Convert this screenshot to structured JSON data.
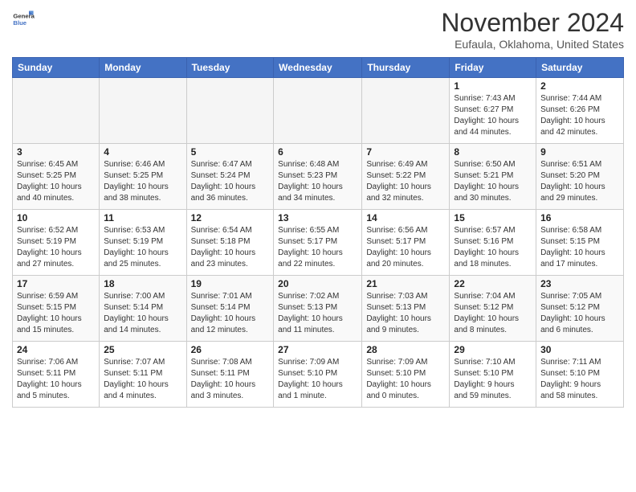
{
  "header": {
    "logo_general": "General",
    "logo_blue": "Blue",
    "month_title": "November 2024",
    "location": "Eufaula, Oklahoma, United States"
  },
  "days_of_week": [
    "Sunday",
    "Monday",
    "Tuesday",
    "Wednesday",
    "Thursday",
    "Friday",
    "Saturday"
  ],
  "weeks": [
    [
      {
        "day": "",
        "info": ""
      },
      {
        "day": "",
        "info": ""
      },
      {
        "day": "",
        "info": ""
      },
      {
        "day": "",
        "info": ""
      },
      {
        "day": "",
        "info": ""
      },
      {
        "day": "1",
        "info": "Sunrise: 7:43 AM\nSunset: 6:27 PM\nDaylight: 10 hours\nand 44 minutes."
      },
      {
        "day": "2",
        "info": "Sunrise: 7:44 AM\nSunset: 6:26 PM\nDaylight: 10 hours\nand 42 minutes."
      }
    ],
    [
      {
        "day": "3",
        "info": "Sunrise: 6:45 AM\nSunset: 5:25 PM\nDaylight: 10 hours\nand 40 minutes."
      },
      {
        "day": "4",
        "info": "Sunrise: 6:46 AM\nSunset: 5:25 PM\nDaylight: 10 hours\nand 38 minutes."
      },
      {
        "day": "5",
        "info": "Sunrise: 6:47 AM\nSunset: 5:24 PM\nDaylight: 10 hours\nand 36 minutes."
      },
      {
        "day": "6",
        "info": "Sunrise: 6:48 AM\nSunset: 5:23 PM\nDaylight: 10 hours\nand 34 minutes."
      },
      {
        "day": "7",
        "info": "Sunrise: 6:49 AM\nSunset: 5:22 PM\nDaylight: 10 hours\nand 32 minutes."
      },
      {
        "day": "8",
        "info": "Sunrise: 6:50 AM\nSunset: 5:21 PM\nDaylight: 10 hours\nand 30 minutes."
      },
      {
        "day": "9",
        "info": "Sunrise: 6:51 AM\nSunset: 5:20 PM\nDaylight: 10 hours\nand 29 minutes."
      }
    ],
    [
      {
        "day": "10",
        "info": "Sunrise: 6:52 AM\nSunset: 5:19 PM\nDaylight: 10 hours\nand 27 minutes."
      },
      {
        "day": "11",
        "info": "Sunrise: 6:53 AM\nSunset: 5:19 PM\nDaylight: 10 hours\nand 25 minutes."
      },
      {
        "day": "12",
        "info": "Sunrise: 6:54 AM\nSunset: 5:18 PM\nDaylight: 10 hours\nand 23 minutes."
      },
      {
        "day": "13",
        "info": "Sunrise: 6:55 AM\nSunset: 5:17 PM\nDaylight: 10 hours\nand 22 minutes."
      },
      {
        "day": "14",
        "info": "Sunrise: 6:56 AM\nSunset: 5:17 PM\nDaylight: 10 hours\nand 20 minutes."
      },
      {
        "day": "15",
        "info": "Sunrise: 6:57 AM\nSunset: 5:16 PM\nDaylight: 10 hours\nand 18 minutes."
      },
      {
        "day": "16",
        "info": "Sunrise: 6:58 AM\nSunset: 5:15 PM\nDaylight: 10 hours\nand 17 minutes."
      }
    ],
    [
      {
        "day": "17",
        "info": "Sunrise: 6:59 AM\nSunset: 5:15 PM\nDaylight: 10 hours\nand 15 minutes."
      },
      {
        "day": "18",
        "info": "Sunrise: 7:00 AM\nSunset: 5:14 PM\nDaylight: 10 hours\nand 14 minutes."
      },
      {
        "day": "19",
        "info": "Sunrise: 7:01 AM\nSunset: 5:14 PM\nDaylight: 10 hours\nand 12 minutes."
      },
      {
        "day": "20",
        "info": "Sunrise: 7:02 AM\nSunset: 5:13 PM\nDaylight: 10 hours\nand 11 minutes."
      },
      {
        "day": "21",
        "info": "Sunrise: 7:03 AM\nSunset: 5:13 PM\nDaylight: 10 hours\nand 9 minutes."
      },
      {
        "day": "22",
        "info": "Sunrise: 7:04 AM\nSunset: 5:12 PM\nDaylight: 10 hours\nand 8 minutes."
      },
      {
        "day": "23",
        "info": "Sunrise: 7:05 AM\nSunset: 5:12 PM\nDaylight: 10 hours\nand 6 minutes."
      }
    ],
    [
      {
        "day": "24",
        "info": "Sunrise: 7:06 AM\nSunset: 5:11 PM\nDaylight: 10 hours\nand 5 minutes."
      },
      {
        "day": "25",
        "info": "Sunrise: 7:07 AM\nSunset: 5:11 PM\nDaylight: 10 hours\nand 4 minutes."
      },
      {
        "day": "26",
        "info": "Sunrise: 7:08 AM\nSunset: 5:11 PM\nDaylight: 10 hours\nand 3 minutes."
      },
      {
        "day": "27",
        "info": "Sunrise: 7:09 AM\nSunset: 5:10 PM\nDaylight: 10 hours\nand 1 minute."
      },
      {
        "day": "28",
        "info": "Sunrise: 7:09 AM\nSunset: 5:10 PM\nDaylight: 10 hours\nand 0 minutes."
      },
      {
        "day": "29",
        "info": "Sunrise: 7:10 AM\nSunset: 5:10 PM\nDaylight: 9 hours\nand 59 minutes."
      },
      {
        "day": "30",
        "info": "Sunrise: 7:11 AM\nSunset: 5:10 PM\nDaylight: 9 hours\nand 58 minutes."
      }
    ]
  ]
}
